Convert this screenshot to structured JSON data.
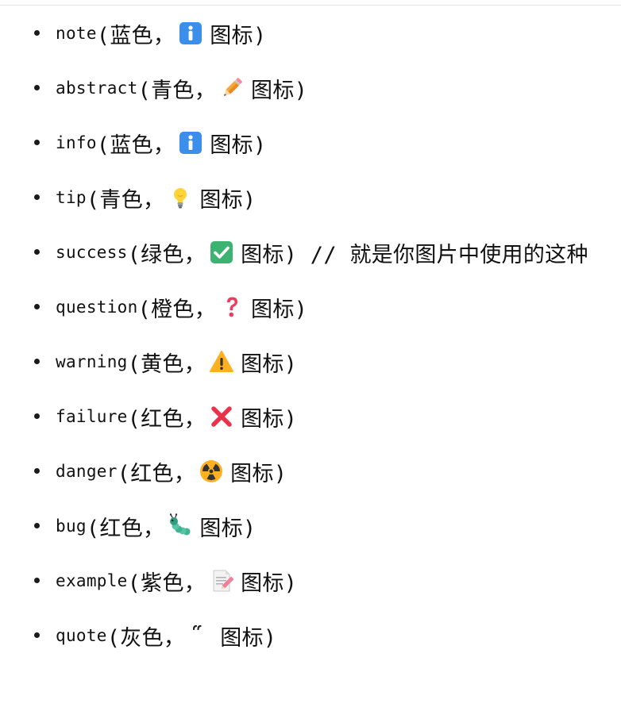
{
  "list": {
    "items": [
      {
        "code": "note",
        "color_text": "(蓝色，",
        "icon": "information-icon",
        "label": "图标)",
        "extra": ""
      },
      {
        "code": "abstract",
        "color_text": "(青色，",
        "icon": "pencil-icon",
        "label": "图标)",
        "extra": ""
      },
      {
        "code": "info",
        "color_text": "(蓝色，",
        "icon": "information-icon",
        "label": "图标)",
        "extra": ""
      },
      {
        "code": "tip",
        "color_text": "(青色，",
        "icon": "lightbulb-icon",
        "label": "图标)",
        "extra": ""
      },
      {
        "code": "success",
        "color_text": "(绿色，",
        "icon": "check-mark-icon",
        "label": "图标)",
        "extra": " // 就是你图片中使用的这种"
      },
      {
        "code": "question",
        "color_text": "(橙色，",
        "icon": "question-mark-icon",
        "label": "图标)",
        "extra": ""
      },
      {
        "code": "warning",
        "color_text": "(黄色，",
        "icon": "warning-icon",
        "label": "图标)",
        "extra": ""
      },
      {
        "code": "failure",
        "color_text": "(红色，",
        "icon": "cross-mark-icon",
        "label": "图标)",
        "extra": ""
      },
      {
        "code": "danger",
        "color_text": "(红色，",
        "icon": "radioactive-icon",
        "label": "图标)",
        "extra": ""
      },
      {
        "code": "bug",
        "color_text": "(红色，",
        "icon": "bug-icon",
        "label": "图标)",
        "extra": ""
      },
      {
        "code": "example",
        "color_text": "(紫色，",
        "icon": "memo-icon",
        "label": "图标)",
        "extra": ""
      },
      {
        "code": "quote",
        "color_text": "(灰色，",
        "icon": "quote-mark-icon",
        "label": "图标)",
        "extra": ""
      }
    ]
  }
}
